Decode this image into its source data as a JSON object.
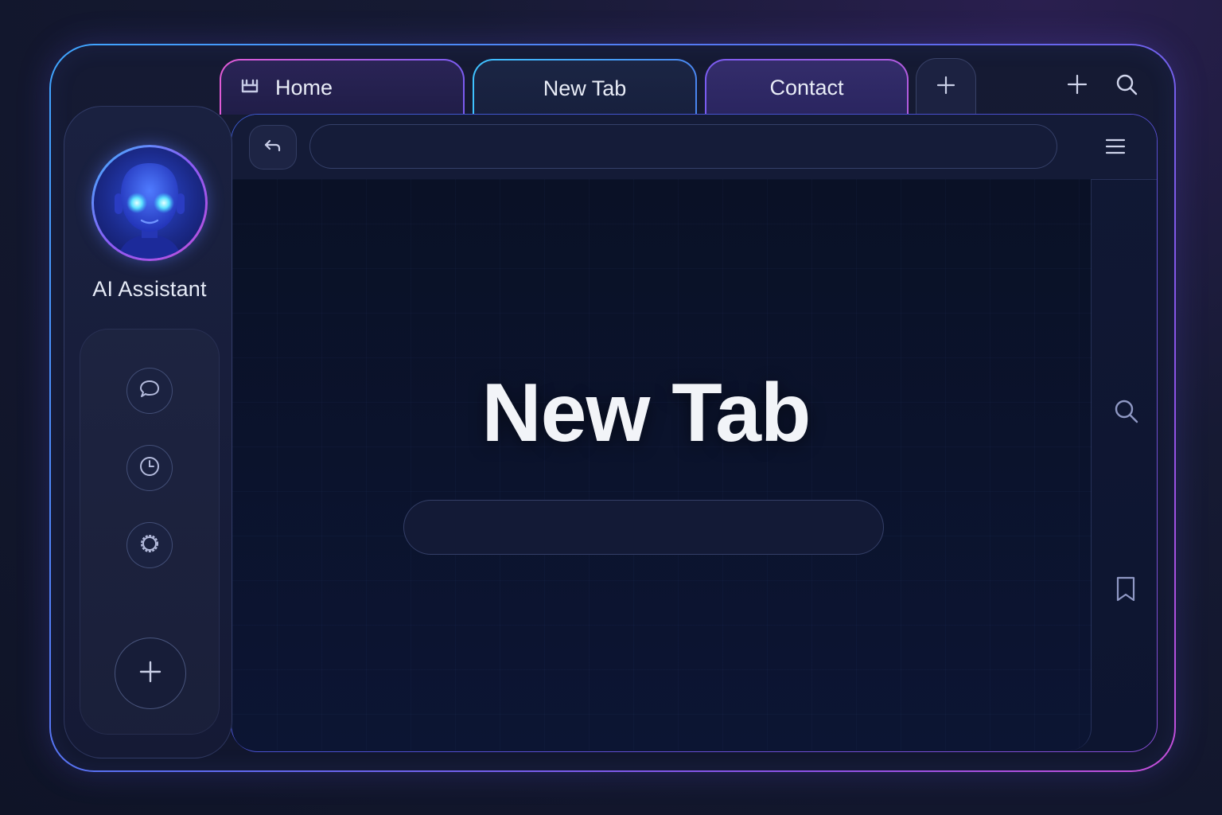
{
  "tabs": [
    {
      "label": "Home",
      "icon": "home-icon",
      "active": false
    },
    {
      "label": "New Tab",
      "active": true
    },
    {
      "label": "Contact",
      "active": false
    }
  ],
  "tab_bar": {
    "add_tab_icon": "plus-icon",
    "new_window_icon": "plus-icon",
    "search_icon": "search-icon"
  },
  "sidebar": {
    "assistant_name": "AI Assistant",
    "avatar_icon": "robot-avatar-icon",
    "buttons": [
      {
        "name": "chat",
        "icon": "chat-bubble-icon"
      },
      {
        "name": "history",
        "icon": "clock-icon"
      },
      {
        "name": "settings",
        "icon": "gear-icon"
      }
    ],
    "add_icon": "plus-icon"
  },
  "toolbar": {
    "back_icon": "back-arrow-icon",
    "address_value": "",
    "address_placeholder": "",
    "menu_icon": "hamburger-menu-icon"
  },
  "page": {
    "title": "New Tab",
    "search_value": "",
    "search_placeholder": ""
  },
  "right_rail": [
    {
      "icon": "search-icon"
    },
    {
      "icon": "bookmark-icon"
    }
  ],
  "colors": {
    "accent_blue": "#3fa6ff",
    "accent_purple": "#8b5cf6",
    "accent_pink": "#c64fd9",
    "background": "#0f1427"
  }
}
